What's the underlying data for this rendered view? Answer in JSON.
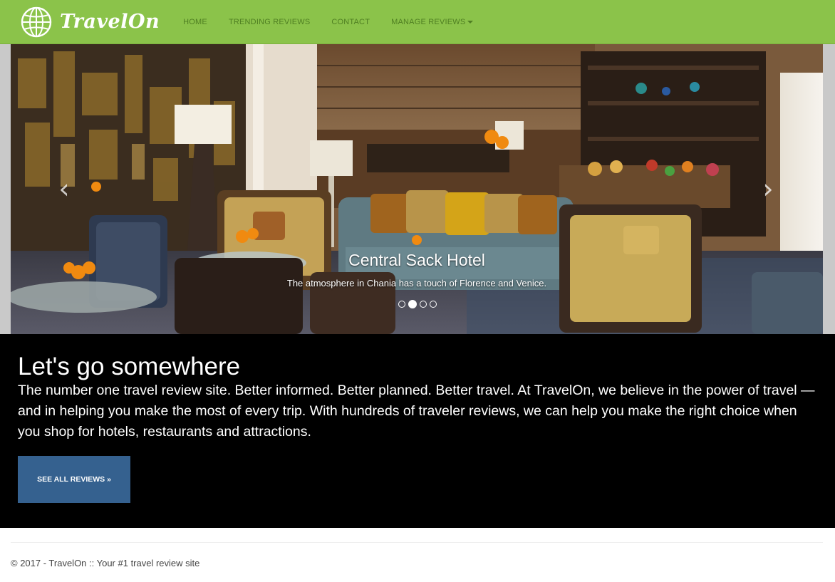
{
  "brand": {
    "name": "TravelOn",
    "logo_icon": "globe-icon",
    "color": "#ffffff"
  },
  "navbar": {
    "background": "#8bc34a",
    "items": [
      {
        "label": "HOME"
      },
      {
        "label": "TRENDING REVIEWS"
      },
      {
        "label": "CONTACT"
      },
      {
        "label": "MANAGE REVIEWS",
        "has_dropdown": true,
        "icon": "caret-down-icon"
      }
    ]
  },
  "carousel": {
    "caption_title": "Central Sack Hotel",
    "caption_text": "The atmosphere in Chania has a touch of Florence and Venice.",
    "prev_icon": "‹",
    "next_icon": "›",
    "slide_count": 4,
    "active_index": 1
  },
  "hero": {
    "title": "Let's go somewhere",
    "text": "The number one travel review site. Better informed. Better planned. Better travel. At TravelOn, we believe in the power of travel — and in helping you make the most of every trip. With hundreds of traveler reviews, we can help you make the right choice when you shop for hotels, restaurants and attractions.",
    "button_label": "SEE ALL REVIEWS »",
    "button_color": "#35618f"
  },
  "footer": {
    "text": "© 2017 - TravelOn :: Your #1 travel review site"
  }
}
